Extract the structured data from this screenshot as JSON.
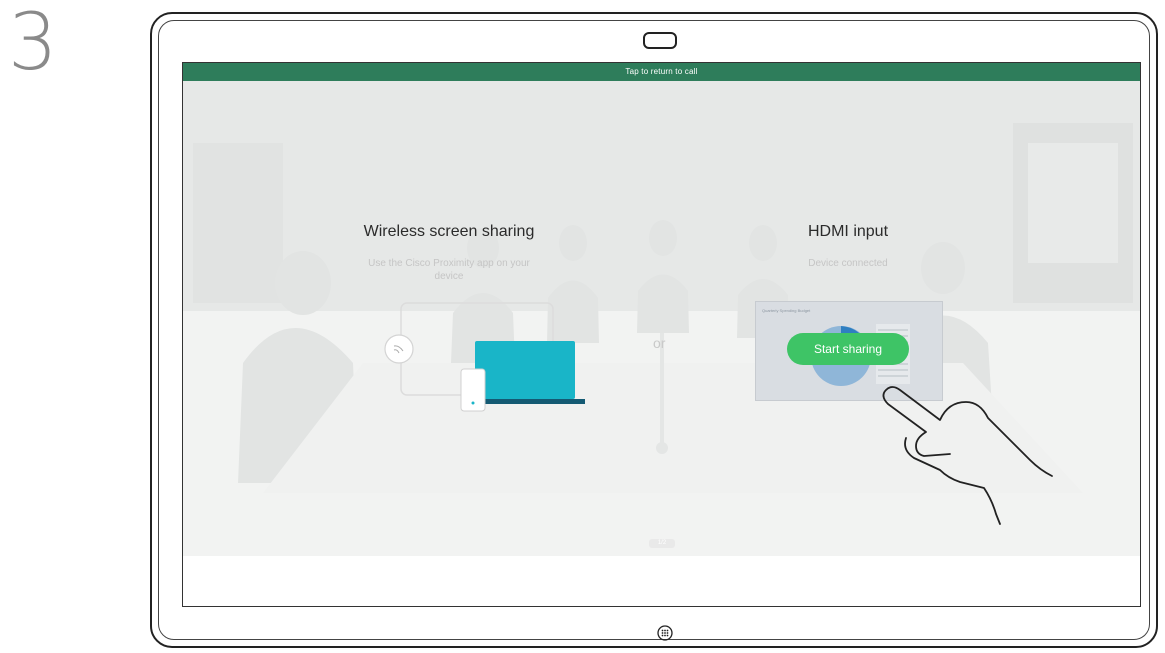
{
  "step": {
    "number": "3"
  },
  "banner": {
    "text": "Tap to return to call",
    "color": "#2e7d5b"
  },
  "wireless": {
    "title": "Wireless screen sharing",
    "subtitle": "Use the Cisco Proximity app on your device"
  },
  "divider": {
    "text": "or"
  },
  "hdmi": {
    "title": "HDMI input",
    "subtitle": "Device connected",
    "preview_caption": "Quarterly Spending Budget",
    "start_button": "Start sharing",
    "button_color": "#3ec466"
  },
  "page_indicator": {
    "text": "1/2"
  },
  "icons": {
    "laptop": "laptop-icon",
    "phone": "phone-icon",
    "wireless": "wireless-signal-icon",
    "home": "home-button-icon",
    "hand": "pointing-hand-icon"
  }
}
